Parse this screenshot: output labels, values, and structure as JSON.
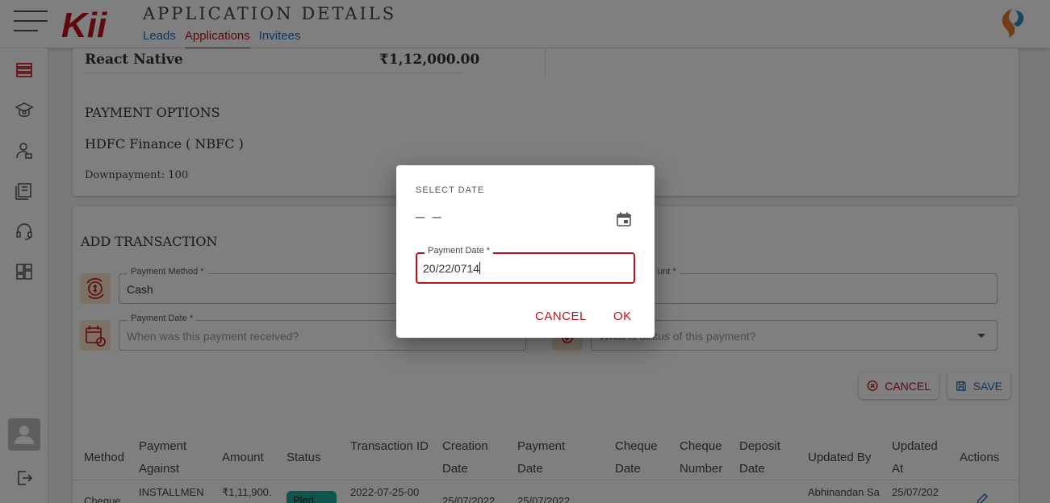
{
  "header": {
    "logo_text": "Kii",
    "title": "APPLICATION DETAILS",
    "tabs": [
      {
        "label": "Leads"
      },
      {
        "label": "Applications"
      },
      {
        "label": "Invitees"
      }
    ],
    "active_tab": "Applications"
  },
  "sidebar": {
    "items": [
      {
        "icon": "graduation-cap-icon"
      },
      {
        "icon": "school-icon"
      },
      {
        "icon": "user-student-icon"
      },
      {
        "icon": "books-icon"
      },
      {
        "icon": "headset-icon"
      },
      {
        "icon": "dashboard-grid-icon"
      }
    ]
  },
  "course": {
    "name": "React Native",
    "price": "₹1,12,000.00",
    "payment_options_heading": "PAYMENT OPTIONS",
    "finance": "HDFC Finance ( NBFC )",
    "downpayment": "Downpayment: 100"
  },
  "add_transaction": {
    "heading": "ADD TRANSACTION",
    "payment_method_label": "Payment Method *",
    "payment_method_value": "Cash",
    "amount_label": "unt *",
    "payment_date_label": "Payment Date *",
    "payment_date_placeholder": "When was this payment received?",
    "status_placeholder": "What is status of this payment?",
    "cancel_label": "CANCEL",
    "save_label": "SAVE"
  },
  "table": {
    "headers": [
      "Method",
      "Payment Against",
      "Amount",
      "Status",
      "Transaction ID",
      "Creation Date",
      "Payment Date",
      "Cheque Date",
      "Cheque Number",
      "Deposit Date",
      "Updated By",
      "Updated At",
      "Actions"
    ],
    "rows": [
      {
        "method": "Cheque",
        "payment_against": "INSTALLMEN",
        "amount": "₹1,11,900.",
        "status": "Pled",
        "transaction_id": "2022-07-25-00",
        "creation_date": "25/07/2022",
        "payment_date": "25/07/2022",
        "updated_by": "Abhinandan Sa",
        "updated_at": "25/07/202"
      }
    ]
  },
  "dialog": {
    "title": "SELECT DATE",
    "date_display": "– –",
    "field_label": "Payment Date *",
    "field_value": "20/22/0714",
    "cancel_label": "CANCEL",
    "ok_label": "OK"
  },
  "colors": {
    "accent_red": "#c0101c",
    "link_blue": "#1d6fbf",
    "status_teal": "#1fa99a",
    "icon_bg": "#f6e3c8"
  }
}
